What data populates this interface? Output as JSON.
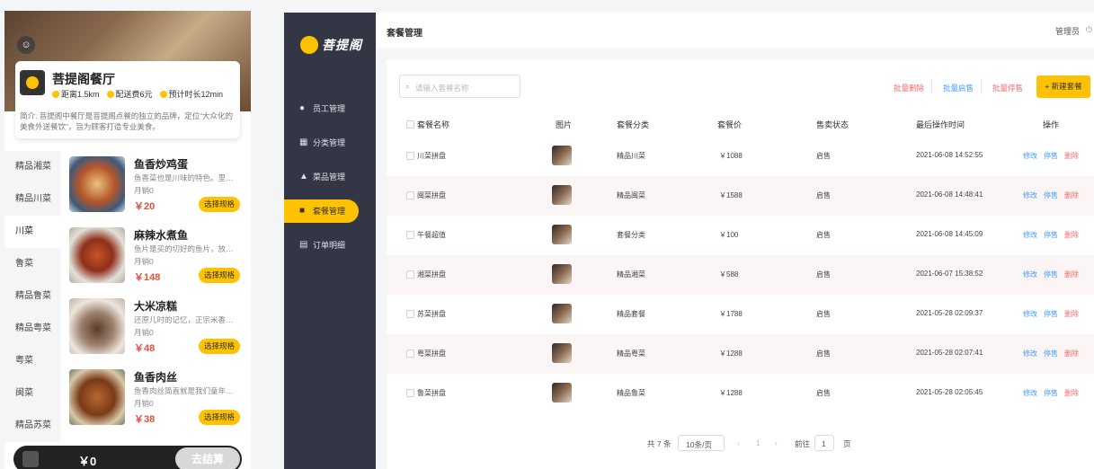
{
  "mobile": {
    "shop": {
      "name": "菩提阁餐厅",
      "distance": "距离1.5km",
      "delivery_fee": "配送费6元",
      "eta": "预计时长12min",
      "intro": "简介: 菩提阁中餐厅是菩提阁点餐的独立的品牌，定位“大众化的美食外送餐饮”，旨为顾客打造专业美食。"
    },
    "categories": [
      "精品湘菜",
      "精品川菜",
      "川菜",
      "鲁菜",
      "精品鲁菜",
      "精品粤菜",
      "粤菜",
      "闽菜",
      "精品苏菜"
    ],
    "active_category": "川菜",
    "dishes": [
      {
        "name": "鱼香炒鸡蛋",
        "desc": "鱼香菜也是川味的特色。里面无鱼…",
        "sales": "月销0",
        "price": "￥20",
        "spec": "选择规格"
      },
      {
        "name": "麻辣水煮鱼",
        "desc": "鱼片是买的切好的鱼片，放的时候…",
        "sales": "月销0",
        "price": "￥148",
        "spec": "选择规格"
      },
      {
        "name": "大米凉糕",
        "desc": "还原儿时的记忆，正宗米香糕…",
        "sales": "月销0",
        "price": "￥48",
        "spec": "选择规格"
      },
      {
        "name": "鱼香肉丝",
        "desc": "鱼香肉丝简直就是我们童年的记忆…",
        "sales": "月销0",
        "price": "￥38",
        "spec": "选择规格"
      }
    ],
    "cart": {
      "total": "￥0",
      "checkout": "去结算"
    }
  },
  "admin": {
    "brand": "菩提阁",
    "menu": [
      {
        "label": "员工管理",
        "icon": "info-icon"
      },
      {
        "label": "分类管理",
        "icon": "grid-icon"
      },
      {
        "label": "菜品管理",
        "icon": "dish-icon"
      },
      {
        "label": "套餐管理",
        "icon": "gift-icon"
      },
      {
        "label": "订单明细",
        "icon": "doc-icon"
      }
    ],
    "active_menu": "套餐管理",
    "page_title": "套餐管理",
    "user": "管理员",
    "search_placeholder": "请输入套餐名称",
    "actions": {
      "batch_delete": "批量删除",
      "batch_enable": "批量启售",
      "batch_disable": "批量停售",
      "add": "+ 新建套餐"
    },
    "columns": [
      "套餐名称",
      "图片",
      "套餐分类",
      "套餐价",
      "售卖状态",
      "最后操作时间",
      "操作"
    ],
    "rows": [
      {
        "name": "川菜拼盘",
        "category": "精品川菜",
        "price": "￥1088",
        "status": "启售",
        "time": "2021-06-08 14:52:55"
      },
      {
        "name": "闽菜拼盘",
        "category": "精品闽菜",
        "price": "￥1588",
        "status": "启售",
        "time": "2021-06-08 14:48:41"
      },
      {
        "name": "午餐超值",
        "category": "套餐分类",
        "price": "￥100",
        "status": "启售",
        "time": "2021-06-08 14:45:09"
      },
      {
        "name": "湘菜拼盘",
        "category": "精品湘菜",
        "price": "￥588",
        "status": "启售",
        "time": "2021-06-07 15:38:52"
      },
      {
        "name": "苏菜拼盘",
        "category": "精品套餐",
        "price": "￥1788",
        "status": "启售",
        "time": "2021-05-28 02:09:37"
      },
      {
        "name": "粤菜拼盘",
        "category": "精品粤菜",
        "price": "￥1288",
        "status": "启售",
        "time": "2021-05-28 02:07:41"
      },
      {
        "name": "鲁菜拼盘",
        "category": "精品鲁菜",
        "price": "￥1288",
        "status": "启售",
        "time": "2021-05-28 02:05:45"
      }
    ],
    "row_actions": {
      "edit": "修改",
      "stop": "停售",
      "delete": "删除"
    },
    "pager": {
      "total": "共 7 条",
      "page_size": "10条/页",
      "prev": "‹",
      "current": "1",
      "next": "›",
      "goto": "前往",
      "goto_value": "1",
      "page_unit": "页"
    },
    "colors": {
      "accent": "#ffc200",
      "sidebar": "#333644",
      "link": "#409eff",
      "danger": "#f56c6c"
    }
  }
}
